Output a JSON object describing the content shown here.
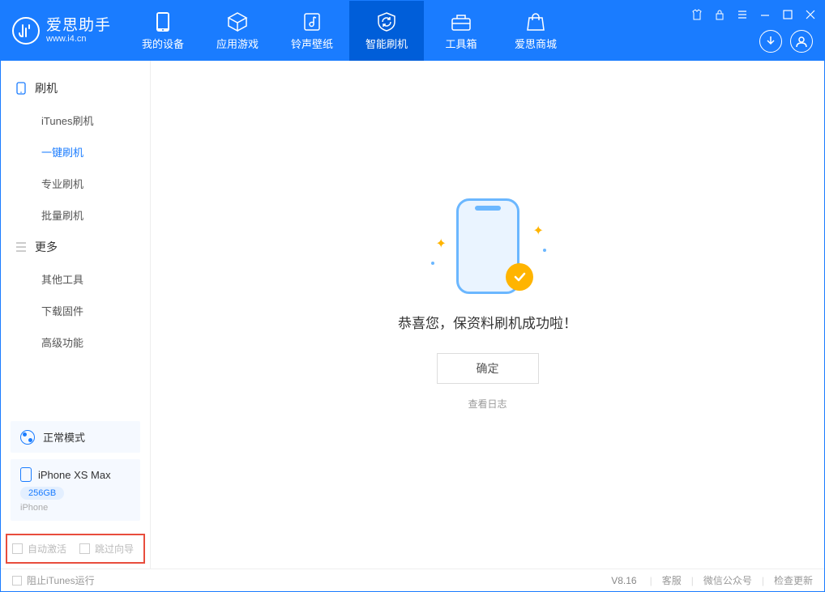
{
  "app": {
    "name_cn": "爱思助手",
    "url": "www.i4.cn"
  },
  "top_tabs": [
    {
      "label": "我的设备"
    },
    {
      "label": "应用游戏"
    },
    {
      "label": "铃声壁纸"
    },
    {
      "label": "智能刷机"
    },
    {
      "label": "工具箱"
    },
    {
      "label": "爱思商城"
    }
  ],
  "sidebar": {
    "group1": {
      "title": "刷机"
    },
    "group1_items": [
      {
        "label": "iTunes刷机"
      },
      {
        "label": "一键刷机"
      },
      {
        "label": "专业刷机"
      },
      {
        "label": "批量刷机"
      }
    ],
    "group2": {
      "title": "更多"
    },
    "group2_items": [
      {
        "label": "其他工具"
      },
      {
        "label": "下载固件"
      },
      {
        "label": "高级功能"
      }
    ],
    "mode": "正常模式",
    "device": {
      "name": "iPhone XS Max",
      "capacity": "256GB",
      "type": "iPhone"
    },
    "checks": {
      "auto_activate": "自动激活",
      "skip_guide": "跳过向导"
    }
  },
  "main": {
    "success": "恭喜您，保资料刷机成功啦！",
    "ok": "确定",
    "view_log": "查看日志"
  },
  "footer": {
    "block_itunes": "阻止iTunes运行",
    "version": "V8.16",
    "support": "客服",
    "wechat": "微信公众号",
    "check_update": "检查更新"
  }
}
